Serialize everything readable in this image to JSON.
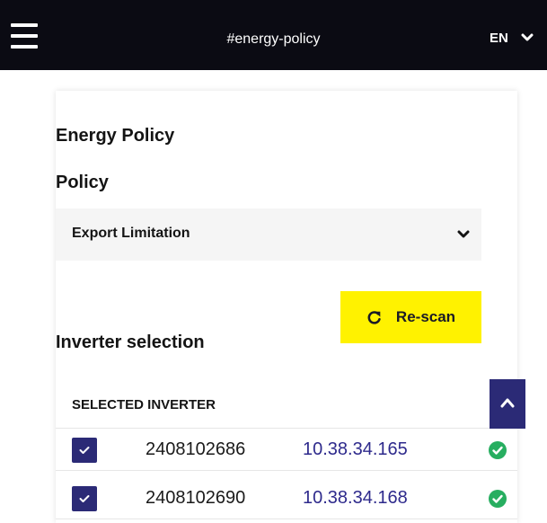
{
  "header": {
    "title": "#energy-policy",
    "language": "EN",
    "menu_icon": "hamburger-menu-icon",
    "language_chevron_icon": "chevron-down-icon"
  },
  "energy_policy": {
    "heading": "Energy Policy",
    "policy_label": "Policy",
    "policy_selected": "Export Limitation",
    "select_chevron_icon": "chevron-down-icon"
  },
  "rescan": {
    "label": "Re-scan",
    "icon": "refresh-icon",
    "color": "#fff200"
  },
  "inverter_selection": {
    "heading": "Inverter selection",
    "column_header": "SELECTED INVERTER",
    "collapse_icon": "chevron-up-icon",
    "rows": [
      {
        "checked": true,
        "serial": "2408102686",
        "ip": "10.38.34.165",
        "status": "ok"
      },
      {
        "checked": true,
        "serial": "2408102690",
        "ip": "10.38.34.168",
        "status": "ok"
      }
    ]
  },
  "colors": {
    "topbar": "#0b0b13",
    "accent": "#2b2a76",
    "status_ok": "#27ae60",
    "ip_link": "#2e2a8c"
  }
}
